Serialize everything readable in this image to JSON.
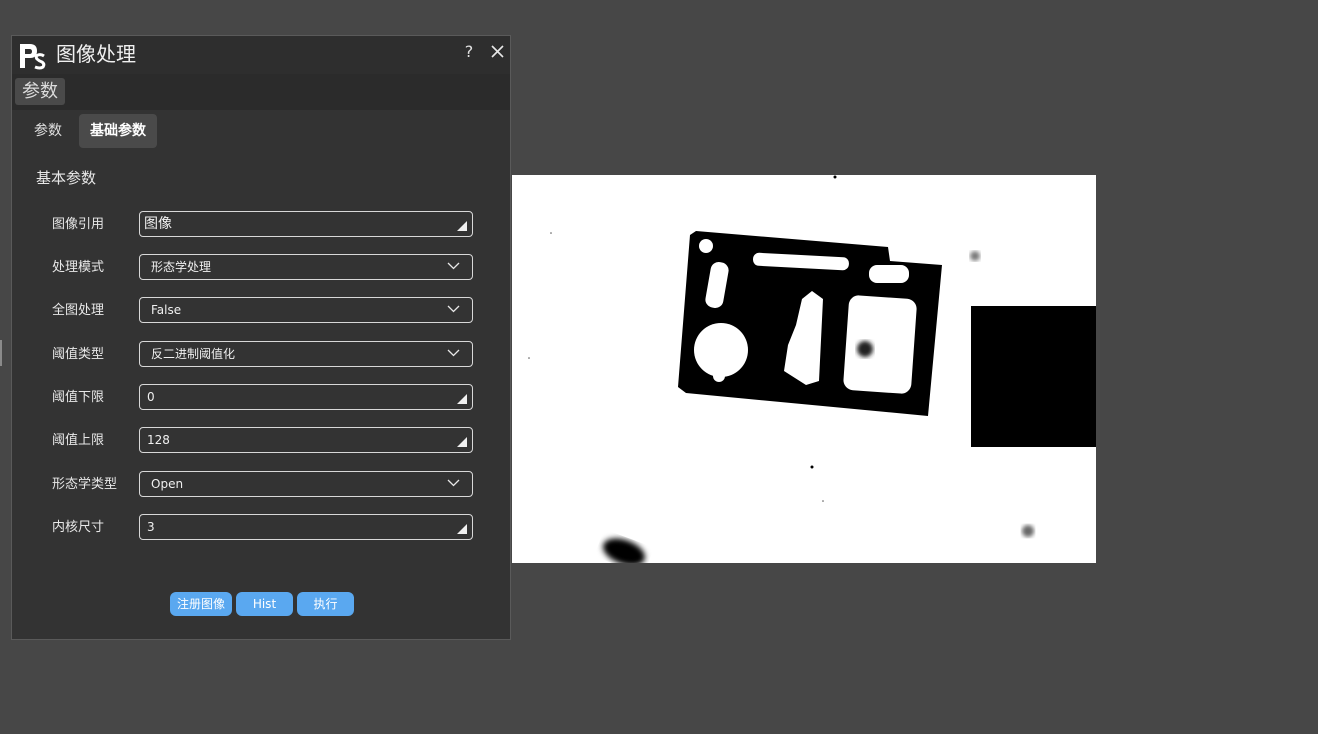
{
  "dialog": {
    "title": "图像处理",
    "help_label": "?",
    "section_label": "参数",
    "logo_icon": "photoshop-logo-icon",
    "tabs": [
      {
        "label": "参数",
        "active": false
      },
      {
        "label": "基础参数",
        "active": true
      }
    ],
    "group_title": "基本参数",
    "rows": [
      {
        "label": "图像引用",
        "value": "图像",
        "control": "picker"
      },
      {
        "label": "处理模式",
        "value": "形态学处理",
        "control": "dropdown"
      },
      {
        "label": "全图处理",
        "value": "False",
        "control": "dropdown"
      },
      {
        "label": "阈值类型",
        "value": "反二进制阈值化",
        "control": "dropdown"
      },
      {
        "label": "阈值下限",
        "value": "0",
        "control": "picker"
      },
      {
        "label": "阈值上限",
        "value": "128",
        "control": "picker"
      },
      {
        "label": "形态学类型",
        "value": "Open",
        "control": "dropdown"
      },
      {
        "label": "内核尺寸",
        "value": "3",
        "control": "picker"
      }
    ],
    "buttons": {
      "register": "注册图像",
      "hist": "Hist",
      "run": "执行"
    }
  },
  "colors": {
    "background": "#474747",
    "dialog": "#333333",
    "accent_button": "#5aa8f0"
  }
}
